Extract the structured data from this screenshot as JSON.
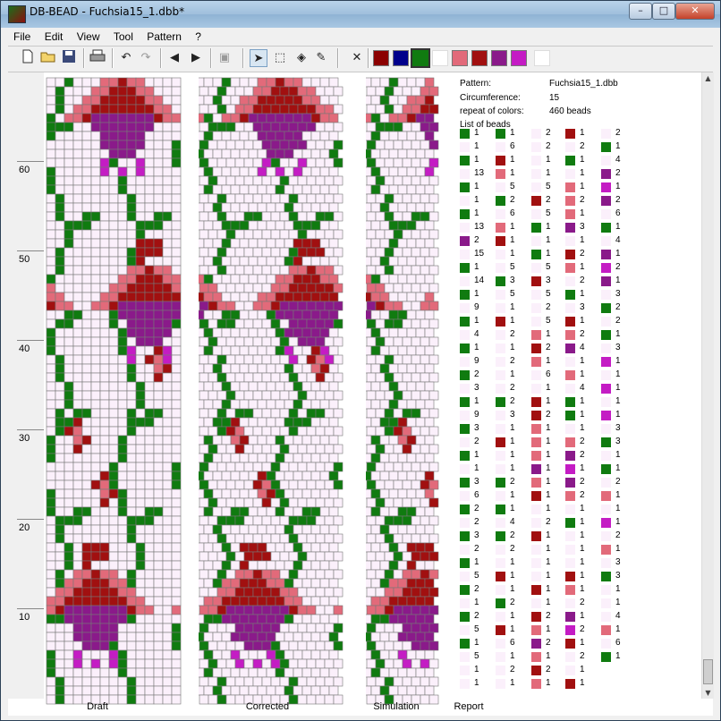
{
  "window": {
    "title": "DB-BEAD - Fuchsia15_1.dbb*",
    "min": "–",
    "max": "□",
    "close": "✕"
  },
  "menu": [
    "File",
    "Edit",
    "View",
    "Tool",
    "Pattern",
    "?"
  ],
  "toolbar": {
    "icons": [
      "new-icon",
      "open-icon",
      "save-icon",
      "print-icon",
      "undo-icon",
      "redo-icon",
      "arrow-left-icon",
      "arrow-right-icon",
      "paste-icon",
      "pointer-icon",
      "select-rect-icon",
      "fill-icon",
      "pipette-icon",
      "clear-icon"
    ],
    "colors": [
      "#8b0000",
      "#00008b",
      "#107b10",
      "#ffffff",
      "#e26a7a",
      "#a11010",
      "#8a1a8a",
      "#c41cc4",
      "#ffffff"
    ],
    "selected_color": 2
  },
  "ruler": [
    "60",
    "50",
    "40",
    "30",
    "20",
    "10"
  ],
  "panes": {
    "draft": "Draft",
    "corrected": "Corrected",
    "simulation": "Simulation",
    "report": "Report"
  },
  "report": {
    "pattern_label": "Pattern:",
    "pattern_value": "Fuchsia15_1.dbb",
    "circ_label": "Circumference:",
    "circ_value": "15",
    "repeat_label": "repeat of colors:",
    "repeat_value": "460 beads",
    "list_label": "List of beads"
  },
  "bead_colors": {
    "G": "#107b10",
    "W": "#fbf0fb",
    "R": "#a11010",
    "P": "#e26a7a",
    "V": "#8a1a8a",
    "M": "#c41cc4"
  },
  "beads": [
    [
      [
        "G",
        "1"
      ],
      [
        "G",
        "1"
      ],
      [
        "W",
        "2"
      ],
      [
        "R",
        "1"
      ],
      [
        "W",
        "2"
      ]
    ],
    [
      [
        "W",
        "1"
      ],
      [
        "W",
        "6"
      ],
      [
        "W",
        "2"
      ],
      [
        "W",
        "2"
      ],
      [
        "G",
        "1"
      ]
    ],
    [
      [
        "G",
        "1"
      ],
      [
        "R",
        "1"
      ],
      [
        "W",
        "1"
      ],
      [
        "G",
        "1"
      ],
      [
        "W",
        "4"
      ]
    ],
    [
      [
        "W",
        "13"
      ],
      [
        "P",
        "1"
      ],
      [
        "W",
        "1"
      ],
      [
        "W",
        "1"
      ],
      [
        "V",
        "2"
      ]
    ],
    [
      [
        "G",
        "1"
      ],
      [
        "W",
        "5"
      ],
      [
        "W",
        "5"
      ],
      [
        "P",
        "1"
      ],
      [
        "M",
        "1"
      ]
    ],
    [
      [
        "W",
        "1"
      ],
      [
        "G",
        "2"
      ],
      [
        "R",
        "2"
      ],
      [
        "P",
        "2"
      ],
      [
        "V",
        "2"
      ]
    ],
    [
      [
        "G",
        "1"
      ],
      [
        "W",
        "6"
      ],
      [
        "W",
        "5"
      ],
      [
        "P",
        "1"
      ],
      [
        "W",
        "6"
      ]
    ],
    [
      [
        "W",
        "13"
      ],
      [
        "P",
        "1"
      ],
      [
        "G",
        "1"
      ],
      [
        "V",
        "3"
      ],
      [
        "G",
        "1"
      ]
    ],
    [
      [
        "V",
        "2"
      ],
      [
        "R",
        "1"
      ],
      [
        "W",
        "1"
      ],
      [
        "W",
        "1"
      ],
      [
        "W",
        "4"
      ]
    ],
    [
      [
        "W",
        "15"
      ],
      [
        "W",
        "1"
      ],
      [
        "G",
        "1"
      ],
      [
        "R",
        "2"
      ],
      [
        "V",
        "1"
      ]
    ],
    [
      [
        "G",
        "1"
      ],
      [
        "W",
        "5"
      ],
      [
        "W",
        "5"
      ],
      [
        "P",
        "1"
      ],
      [
        "M",
        "2"
      ]
    ],
    [
      [
        "W",
        "14"
      ],
      [
        "G",
        "3"
      ],
      [
        "R",
        "3"
      ],
      [
        "W",
        "2"
      ],
      [
        "V",
        "1"
      ]
    ],
    [
      [
        "G",
        "1"
      ],
      [
        "W",
        "5"
      ],
      [
        "W",
        "5"
      ],
      [
        "G",
        "1"
      ],
      [
        "W",
        "3"
      ]
    ],
    [
      [
        "W",
        "9"
      ],
      [
        "W",
        "1"
      ],
      [
        "W",
        "2"
      ],
      [
        "W",
        "3"
      ],
      [
        "G",
        "2"
      ]
    ],
    [
      [
        "G",
        "1"
      ],
      [
        "R",
        "1"
      ],
      [
        "W",
        "5"
      ],
      [
        "R",
        "1"
      ],
      [
        "W",
        "2"
      ]
    ],
    [
      [
        "W",
        "4"
      ],
      [
        "W",
        "2"
      ],
      [
        "P",
        "1"
      ],
      [
        "P",
        "2"
      ],
      [
        "G",
        "1"
      ]
    ],
    [
      [
        "G",
        "1"
      ],
      [
        "W",
        "1"
      ],
      [
        "R",
        "2"
      ],
      [
        "V",
        "4"
      ],
      [
        "W",
        "3"
      ]
    ],
    [
      [
        "W",
        "9"
      ],
      [
        "W",
        "2"
      ],
      [
        "P",
        "1"
      ],
      [
        "W",
        "1"
      ],
      [
        "M",
        "1"
      ]
    ],
    [
      [
        "G",
        "2"
      ],
      [
        "W",
        "1"
      ],
      [
        "W",
        "6"
      ],
      [
        "P",
        "1"
      ],
      [
        "W",
        "1"
      ]
    ],
    [
      [
        "W",
        "3"
      ],
      [
        "W",
        "2"
      ],
      [
        "W",
        "1"
      ],
      [
        "W",
        "4"
      ],
      [
        "M",
        "1"
      ]
    ],
    [
      [
        "G",
        "1"
      ],
      [
        "G",
        "2"
      ],
      [
        "R",
        "1"
      ],
      [
        "G",
        "1"
      ],
      [
        "W",
        "1"
      ]
    ],
    [
      [
        "W",
        "9"
      ],
      [
        "W",
        "3"
      ],
      [
        "R",
        "2"
      ],
      [
        "G",
        "1"
      ],
      [
        "M",
        "1"
      ]
    ],
    [
      [
        "G",
        "3"
      ],
      [
        "W",
        "1"
      ],
      [
        "P",
        "1"
      ],
      [
        "W",
        "1"
      ],
      [
        "W",
        "3"
      ]
    ],
    [
      [
        "W",
        "2"
      ],
      [
        "R",
        "1"
      ],
      [
        "P",
        "1"
      ],
      [
        "P",
        "2"
      ],
      [
        "G",
        "3"
      ]
    ],
    [
      [
        "G",
        "1"
      ],
      [
        "W",
        "1"
      ],
      [
        "P",
        "1"
      ],
      [
        "V",
        "2"
      ],
      [
        "W",
        "1"
      ]
    ],
    [
      [
        "W",
        "1"
      ],
      [
        "W",
        "1"
      ],
      [
        "V",
        "1"
      ],
      [
        "M",
        "1"
      ],
      [
        "G",
        "1"
      ]
    ],
    [
      [
        "G",
        "3"
      ],
      [
        "G",
        "2"
      ],
      [
        "P",
        "1"
      ],
      [
        "V",
        "2"
      ],
      [
        "W",
        "2"
      ]
    ],
    [
      [
        "W",
        "6"
      ],
      [
        "W",
        "1"
      ],
      [
        "R",
        "1"
      ],
      [
        "P",
        "2"
      ],
      [
        "P",
        "1"
      ]
    ],
    [
      [
        "G",
        "2"
      ],
      [
        "G",
        "1"
      ],
      [
        "W",
        "1"
      ],
      [
        "W",
        "1"
      ],
      [
        "W",
        "1"
      ]
    ],
    [
      [
        "W",
        "2"
      ],
      [
        "W",
        "4"
      ],
      [
        "W",
        "2"
      ],
      [
        "G",
        "1"
      ],
      [
        "M",
        "1"
      ]
    ],
    [
      [
        "G",
        "3"
      ],
      [
        "G",
        "2"
      ],
      [
        "R",
        "1"
      ],
      [
        "W",
        "1"
      ],
      [
        "W",
        "2"
      ]
    ],
    [
      [
        "W",
        "2"
      ],
      [
        "W",
        "2"
      ],
      [
        "W",
        "1"
      ],
      [
        "W",
        "1"
      ],
      [
        "P",
        "1"
      ]
    ],
    [
      [
        "G",
        "1"
      ],
      [
        "W",
        "1"
      ],
      [
        "W",
        "1"
      ],
      [
        "W",
        "1"
      ],
      [
        "W",
        "3"
      ]
    ],
    [
      [
        "W",
        "5"
      ],
      [
        "R",
        "1"
      ],
      [
        "W",
        "1"
      ],
      [
        "R",
        "1"
      ],
      [
        "G",
        "3"
      ]
    ],
    [
      [
        "G",
        "2"
      ],
      [
        "W",
        "1"
      ],
      [
        "R",
        "1"
      ],
      [
        "P",
        "1"
      ],
      [
        "W",
        "1"
      ]
    ],
    [
      [
        "W",
        "1"
      ],
      [
        "G",
        "2"
      ],
      [
        "W",
        "1"
      ],
      [
        "W",
        "2"
      ],
      [
        "W",
        "1"
      ]
    ],
    [
      [
        "G",
        "2"
      ],
      [
        "W",
        "1"
      ],
      [
        "R",
        "2"
      ],
      [
        "V",
        "1"
      ],
      [
        "W",
        "4"
      ]
    ],
    [
      [
        "W",
        "5"
      ],
      [
        "R",
        "1"
      ],
      [
        "P",
        "1"
      ],
      [
        "M",
        "2"
      ],
      [
        "P",
        "1"
      ]
    ],
    [
      [
        "G",
        "1"
      ],
      [
        "W",
        "6"
      ],
      [
        "V",
        "2"
      ],
      [
        "R",
        "1"
      ],
      [
        "W",
        "6"
      ]
    ],
    [
      [
        "W",
        "5"
      ],
      [
        "W",
        "1"
      ],
      [
        "P",
        "1"
      ],
      [
        "W",
        "2"
      ],
      [
        "G",
        "1"
      ]
    ],
    [
      [
        "W",
        "1"
      ],
      [
        "W",
        "2"
      ],
      [
        "R",
        "2"
      ],
      [
        "W",
        "1"
      ],
      null
    ],
    [
      [
        "W",
        "1"
      ],
      [
        "W",
        "1"
      ],
      [
        "P",
        "1"
      ],
      [
        "R",
        "1"
      ],
      null
    ]
  ]
}
